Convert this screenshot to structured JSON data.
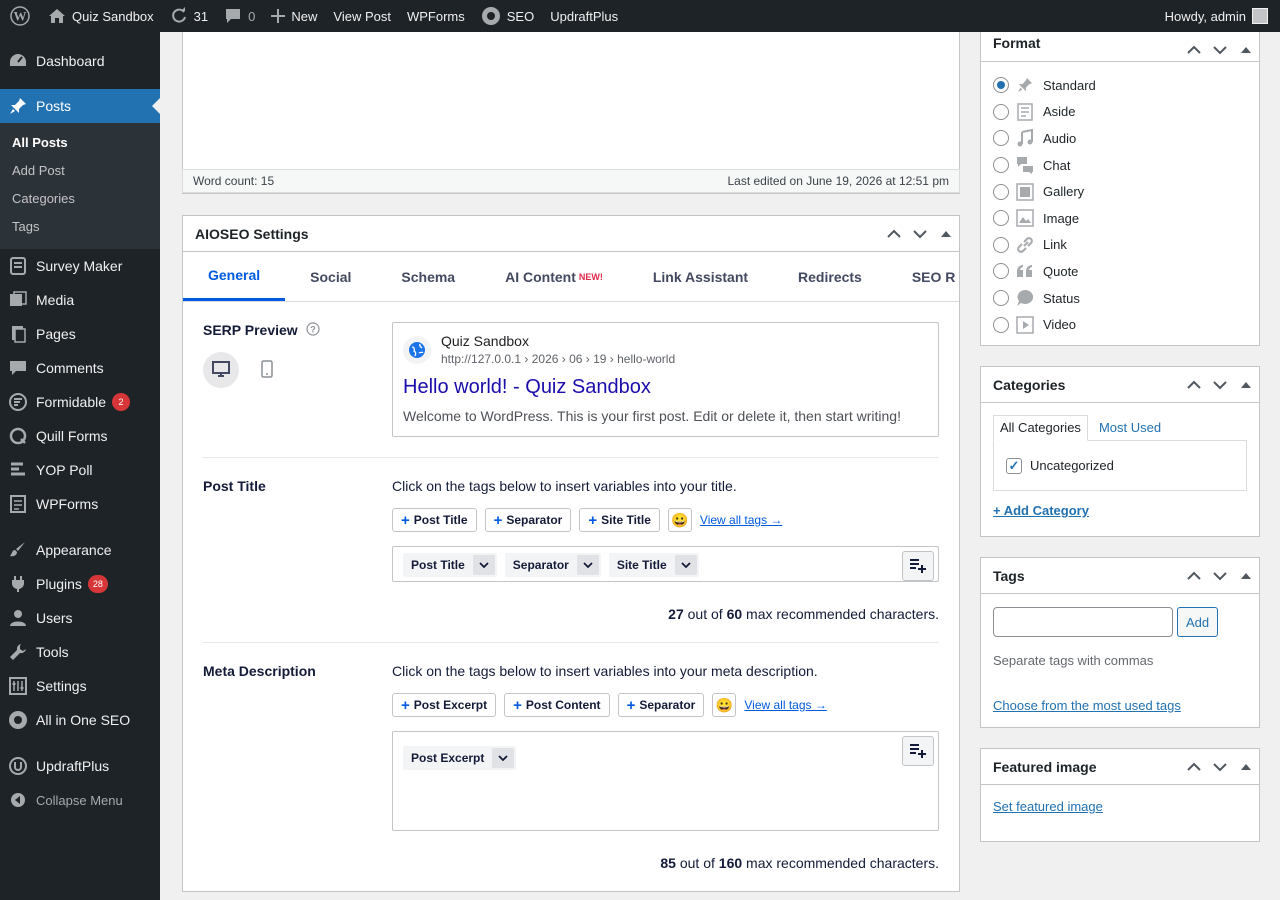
{
  "adminbar": {
    "site_name": "Quiz Sandbox",
    "updates_count": "31",
    "comments_count": "0",
    "new_label": "New",
    "view_post": "View Post",
    "wpforms": "WPForms",
    "seo": "SEO",
    "updraftplus": "UpdraftPlus",
    "howdy": "Howdy, admin"
  },
  "sidebar": {
    "dashboard": "Dashboard",
    "posts": "Posts",
    "posts_sub": [
      "All Posts",
      "Add Post",
      "Categories",
      "Tags"
    ],
    "survey_maker": "Survey Maker",
    "media": "Media",
    "pages": "Pages",
    "comments": "Comments",
    "formidable": "Formidable",
    "formidable_badge": "2",
    "quill_forms": "Quill Forms",
    "yop_poll": "YOP Poll",
    "wpforms": "WPForms",
    "appearance": "Appearance",
    "plugins": "Plugins",
    "plugins_badge": "28",
    "users": "Users",
    "tools": "Tools",
    "settings": "Settings",
    "aioseo": "All in One SEO",
    "updraftplus": "UpdraftPlus",
    "collapse": "Collapse Menu"
  },
  "editor": {
    "word_count": "Word count: 15",
    "last_edited": "Last edited on June 19, 2026 at 12:51 pm"
  },
  "aioseo": {
    "title": "AIOSEO Settings",
    "tabs": [
      "General",
      "Social",
      "Schema",
      "AI Content",
      "Link Assistant",
      "Redirects",
      "SEO R"
    ],
    "new_badge": "NEW!",
    "serp": {
      "label": "SERP Preview",
      "site": "Quiz Sandbox",
      "url": "http://127.0.0.1 › 2026 › 06 › 19 › hello-world",
      "title": "Hello world! - Quiz Sandbox",
      "desc": "Welcome to WordPress. This is your first post. Edit or delete it, then start writing!"
    },
    "post_title": {
      "label": "Post Title",
      "hint": "Click on the tags below to insert variables into your title.",
      "buttons": [
        "Post Title",
        "Separator",
        "Site Title"
      ],
      "view_all": "View all tags →",
      "chips": [
        "Post Title",
        "Separator",
        "Site Title"
      ],
      "count": "27",
      "max": "60",
      "out_of": "out of",
      "suffix": "max recommended characters."
    },
    "meta": {
      "label": "Meta Description",
      "hint": "Click on the tags below to insert variables into your meta description.",
      "buttons": [
        "Post Excerpt",
        "Post Content",
        "Separator"
      ],
      "view_all": "View all tags →",
      "chips": [
        "Post Excerpt"
      ],
      "count": "85",
      "max": "160",
      "out_of": "out of",
      "suffix": "max recommended characters."
    }
  },
  "format": {
    "title": "Format",
    "options": [
      "Standard",
      "Aside",
      "Audio",
      "Chat",
      "Gallery",
      "Image",
      "Link",
      "Quote",
      "Status",
      "Video"
    ],
    "selected": "Standard"
  },
  "categories": {
    "title": "Categories",
    "tab_all": "All Categories",
    "tab_used": "Most Used",
    "item": "Uncategorized",
    "add": "+ Add Category"
  },
  "tags": {
    "title": "Tags",
    "add_button": "Add",
    "hint": "Separate tags with commas",
    "choose": "Choose from the most used tags"
  },
  "featured": {
    "title": "Featured image",
    "set": "Set featured image"
  },
  "icons": [
    "wordpress-icon",
    "home-icon",
    "refresh-icon",
    "comment-icon",
    "plus-icon",
    "seo-icon",
    "avatar",
    "dashboard-icon",
    "pin-icon"
  ]
}
